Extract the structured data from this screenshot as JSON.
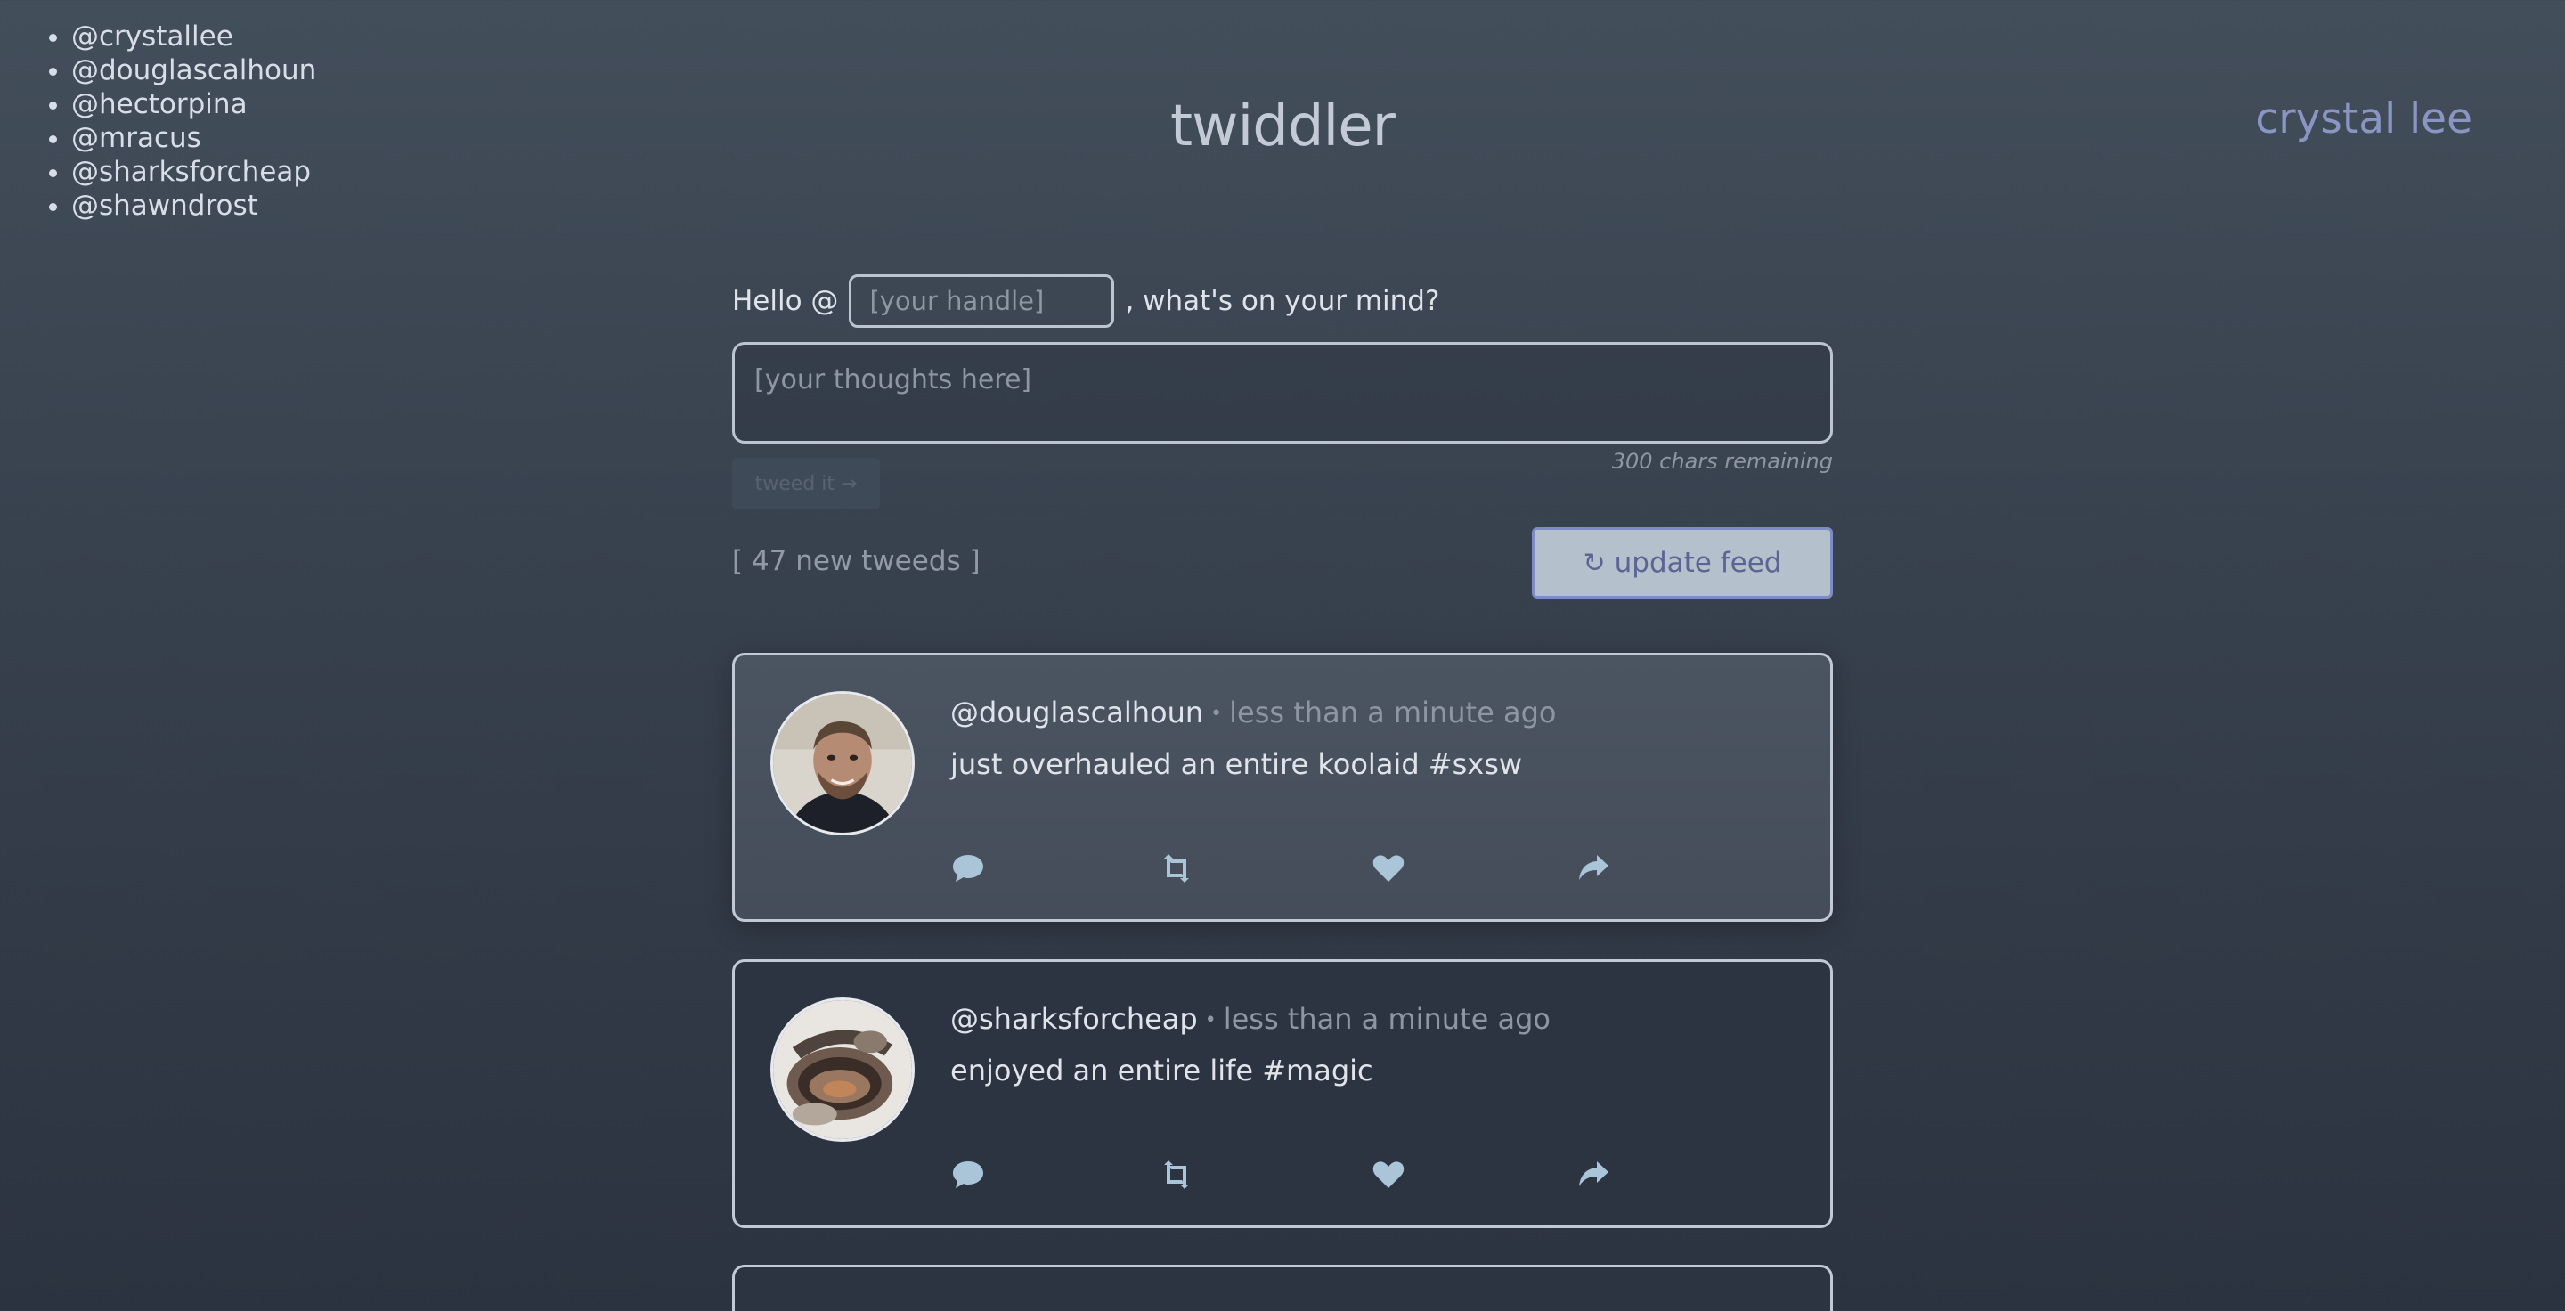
{
  "sidebar": {
    "handles": [
      "@crystallee",
      "@douglascalhoun",
      "@hectorpina",
      "@mracus",
      "@sharksforcheap",
      "@shawndrost"
    ]
  },
  "header": {
    "title": "twiddler",
    "current_user": "crystal lee"
  },
  "composer": {
    "hello_prefix": "Hello @",
    "handle_placeholder": "[your handle]",
    "hello_suffix": ", what's on your mind?",
    "thoughts_placeholder": "[your thoughts here]",
    "tweed_button": "tweed it →",
    "chars_remaining": "300 chars remaining"
  },
  "feed": {
    "new_count": "[ 47 new tweeds ]",
    "update_icon": "↻",
    "update_label": "update feed",
    "tweets": [
      {
        "user": "@douglascalhoun",
        "separator": "•",
        "time": "less than a minute ago",
        "text": "just overhauled an entire koolaid",
        "hashtag": "#sxsw"
      },
      {
        "user": "@sharksforcheap",
        "separator": "•",
        "time": "less than a minute ago",
        "text": "enjoyed an entire life",
        "hashtag": "#magic"
      }
    ]
  },
  "colors": {
    "background_top": "#434e5b",
    "background_bottom": "#2c3340",
    "accent": "#8b95c4",
    "action_icon": "#aac4d8",
    "card_border": "#c2c9d6"
  },
  "icons": {
    "reply": "comment-icon",
    "retweet": "retweet-icon",
    "like": "heart-icon",
    "share": "share-icon"
  }
}
